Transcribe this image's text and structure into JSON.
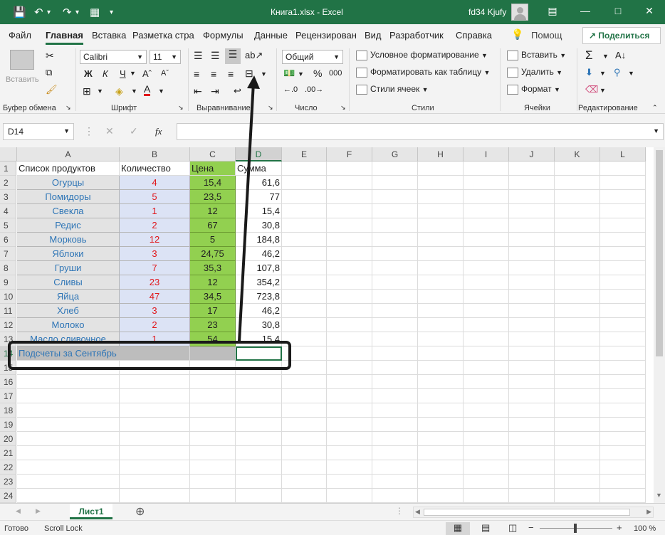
{
  "titlebar": {
    "title": "Книга1.xlsx  -  Excel",
    "user": "fd34 Kjufy"
  },
  "tabs": [
    "Файл",
    "Главная",
    "Вставка",
    "Разметка стра",
    "Формулы",
    "Данные",
    "Рецензирован",
    "Вид",
    "Разработчик",
    "Справка",
    "Помощ"
  ],
  "share_label": "Поделиться",
  "ribbon": {
    "groups": [
      "Буфер обмена",
      "Шрифт",
      "Выравнивание",
      "Число",
      "Стили",
      "Ячейки",
      "Редактирование"
    ],
    "paste_label": "Вставить",
    "font_name": "Calibri",
    "font_size": "11",
    "bold": "Ж",
    "italic": "К",
    "underline": "Ч",
    "number_format": "Общий",
    "percent": "%",
    "thousands": "000",
    "cond_format": "Условное форматирование",
    "format_table": "Форматировать как таблицу",
    "cell_styles": "Стили ячеек",
    "insert": "Вставить",
    "delete": "Удалить",
    "format": "Формат"
  },
  "formula": {
    "namebox": "D14",
    "fx": "fx",
    "value": ""
  },
  "columns": [
    "A",
    "B",
    "C",
    "D",
    "E",
    "F",
    "G",
    "H",
    "I",
    "J",
    "K",
    "L"
  ],
  "rows": [
    [
      "Список продуктов",
      "Количество",
      "Цена",
      "Сумма"
    ],
    [
      "Огурцы",
      "4",
      "15,4",
      "61,6"
    ],
    [
      "Помидоры",
      "5",
      "23,5",
      "77"
    ],
    [
      "Свекла",
      "1",
      "12",
      "15,4"
    ],
    [
      "Редис",
      "2",
      "67",
      "30,8"
    ],
    [
      "Морковь",
      "12",
      "5",
      "184,8"
    ],
    [
      "Яблоки",
      "3",
      "24,75",
      "46,2"
    ],
    [
      "Груши",
      "7",
      "35,3",
      "107,8"
    ],
    [
      "Сливы",
      "23",
      "12",
      "354,2"
    ],
    [
      "Яйца",
      "47",
      "34,5",
      "723,8"
    ],
    [
      "Хлеб",
      "3",
      "17",
      "46,2"
    ],
    [
      "Молоко",
      "2",
      "23",
      "30,8"
    ],
    [
      "Масло сливочное",
      "1",
      "54",
      "15,4"
    ],
    [
      "Подсчеты за Сентябрь",
      "",
      "",
      ""
    ]
  ],
  "sheet": {
    "name": "Лист1"
  },
  "status": {
    "ready": "Готово",
    "scroll": "Scroll Lock",
    "zoom": "100 %"
  },
  "colors": {
    "accent": "#217346",
    "price_fill": "#92d050",
    "qty_fill": "#dce3f5",
    "name_fill": "#e3e3e3",
    "qty_text": "#e0161a",
    "name_text": "#2e75b6"
  }
}
